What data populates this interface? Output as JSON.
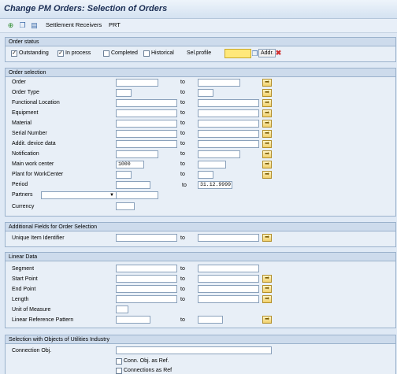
{
  "title": "Change PM Orders: Selection of Orders",
  "toolbar": {
    "settlement": "Settlement Receivers",
    "prt": "PRT"
  },
  "order_status": {
    "title": "Order status",
    "outstanding": "Outstanding",
    "in_process": "In process",
    "completed": "Completed",
    "historical": "Historical",
    "sel_profile": "Sel.profile",
    "addr": "Addr."
  },
  "order_selection": {
    "title": "Order selection",
    "to": "to",
    "order": "Order",
    "order_type": "Order Type",
    "functional_location": "Functional Location",
    "equipment": "Equipment",
    "material": "Material",
    "serial_number": "Serial Number",
    "addit_device_data": "Addit. device data",
    "notification": "Notification",
    "main_work_center": "Main work center",
    "main_work_center_value": "1000",
    "plant_for_workcenter": "Plant for WorkCenter",
    "period": "Period",
    "period_to_value": "31.12.9999",
    "partners": "Partners",
    "currency": "Currency"
  },
  "additional_fields": {
    "title": "Additional Fields for Order Selection",
    "unique_item_identifier": "Unique Item Identifier"
  },
  "linear_data": {
    "title": "Linear Data",
    "segment": "Segment",
    "start_point": "Start Point",
    "end_point": "End Point",
    "length": "Length",
    "unit_of_measure": "Unit of Measure",
    "linear_reference_pattern": "Linear Reference Pattern"
  },
  "utilities": {
    "title": "Selection with Objects of Utilities Industry",
    "connection_obj": "Connection Obj.",
    "conn_obj_as_ref": "Conn. Obj. as Ref.",
    "connections_as_ref": "Connections as Ref"
  }
}
